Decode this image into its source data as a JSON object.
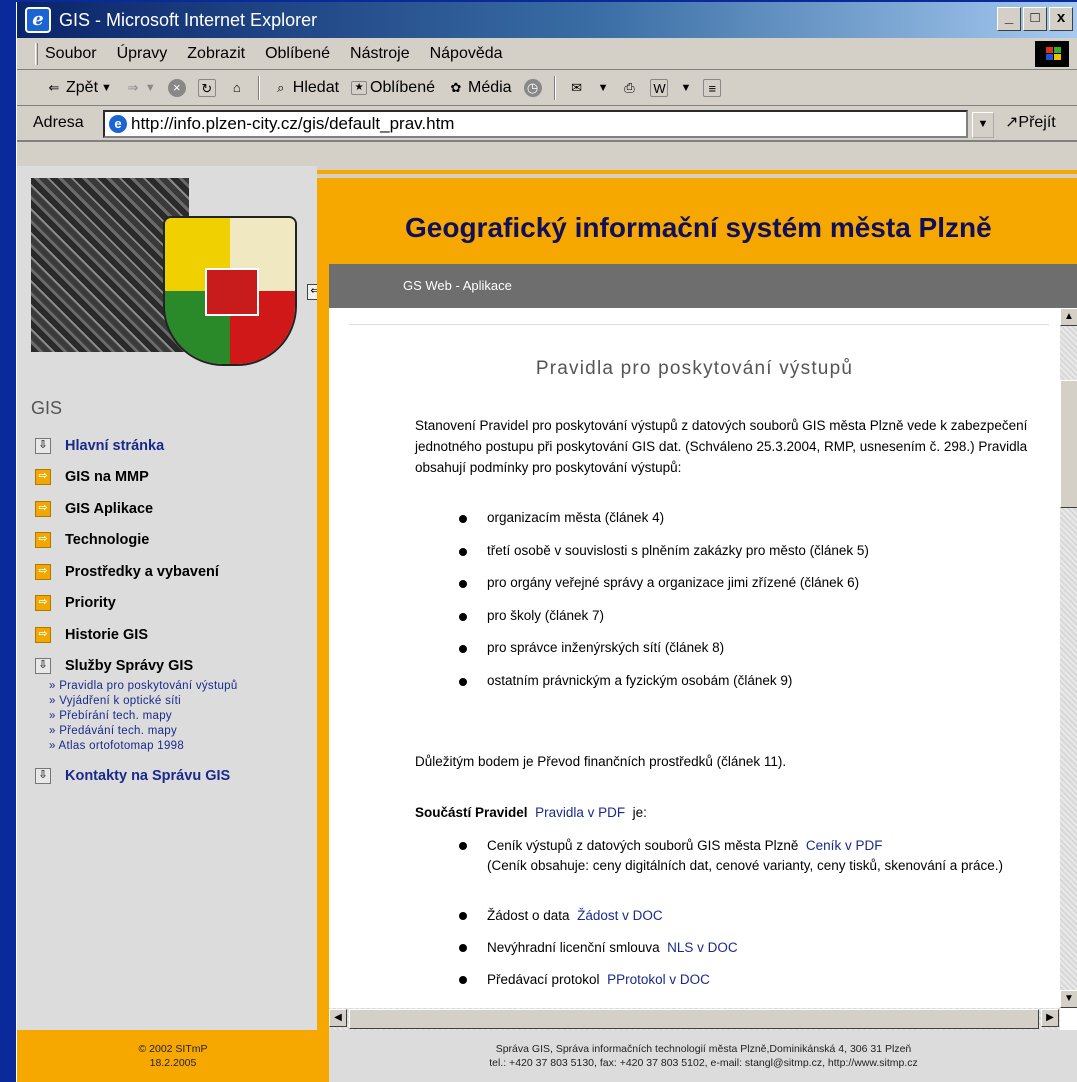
{
  "window": {
    "title": "GIS - Microsoft Internet Explorer",
    "controls": {
      "minimize": "_",
      "maximize": "□",
      "close": "x"
    }
  },
  "menu": [
    "Soubor",
    "Úpravy",
    "Zobrazit",
    "Oblíbené",
    "Nástroje",
    "Nápověda"
  ],
  "toolbar": {
    "back": "Zpět",
    "search": "Hledat",
    "favorites": "Oblíbené",
    "media": "Média"
  },
  "address": {
    "label": "Adresa",
    "url": "http://info.plzen-city.cz/gis/default_prav.htm",
    "go": "Přejít"
  },
  "site": {
    "header_title": "Geografický informační systém města Plzně",
    "subheader": "GS Web - Aplikace",
    "sidebar_heading": "GIS",
    "nav": [
      {
        "label": "Hlavní stránka",
        "icon": "down-arrow-icon"
      },
      {
        "label": "GIS na MMP",
        "icon": "right-arrow-icon"
      },
      {
        "label": "GIS Aplikace",
        "icon": "right-arrow-icon"
      },
      {
        "label": "Technologie",
        "icon": "right-arrow-icon"
      },
      {
        "label": "Prostředky a vybavení",
        "icon": "right-arrow-icon"
      },
      {
        "label": "Priority",
        "icon": "right-arrow-icon"
      },
      {
        "label": "Historie GIS",
        "icon": "right-arrow-icon"
      },
      {
        "label": "Služby Správy GIS",
        "icon": "down-arrow-icon"
      }
    ],
    "subnav": [
      "» Pravidla pro poskytování výstupů",
      "» Vyjádření k optické síti",
      "» Přebírání tech. mapy",
      "» Předávání tech. mapy",
      "» Atlas ortofotomap 1998"
    ],
    "nav_last": "Kontakty na Správu GIS",
    "footer_left": [
      "© 2002 SITmP",
      "18.2.2005"
    ],
    "footer_right": [
      "Správa GIS, Správa informačních technologií města Plzně,Dominikánská 4, 306 31 Plzeň",
      "tel.: +420 37 803 5130, fax: +420 37 803 5102, e-mail: stangl@sitmp.cz, http://www.sitmp.cz"
    ]
  },
  "page": {
    "title": "Pravidla pro poskytování výstupů",
    "intro": "Stanovení Pravidel pro poskytování výstupů z datových souborů GIS města Plzně vede k zabezpečení jednotného postupu při poskytování GIS dat. (Schváleno 25.3.2004, RMP, usnesením č. 298.) Pravidla obsahují podmínky pro poskytování výstupů:",
    "list1": [
      "organizacím města (článek 4)",
      "třetí osobě v souvislosti s plněním zakázky pro město (článek 5)",
      "pro orgány veřejné správy a organizace jimi zřízené (článek 6)",
      "pro školy (článek 7)",
      "pro správce inženýrských sítí (článek 8)",
      "ostatním právnickým a fyzickým osobám (článek 9)"
    ],
    "important": "Důležitým bodem je Převod finančních prostředků (článek 11).",
    "part_label": "Součástí Pravidel",
    "part_link": "Pravidla v PDF",
    "part_suffix": "je:",
    "list2": [
      {
        "text": "Ceník výstupů z datových souborů GIS města Plzně",
        "link": "Ceník v PDF",
        "note": "(Ceník obsahuje: ceny digitálních dat, cenové varianty, ceny tisků, skenování a práce.)"
      },
      {
        "text": "Žádost o data",
        "link": "Žádost v DOC"
      },
      {
        "text": "Nevýhradní licenční smlouva",
        "link": "NLS v DOC"
      },
      {
        "text": "Předávací protokol",
        "link": "PProtokol v DOC"
      }
    ]
  }
}
